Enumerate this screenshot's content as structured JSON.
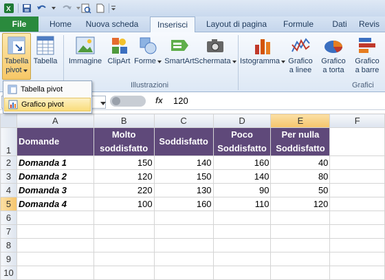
{
  "ribbon_tabs": [
    {
      "label": "File"
    },
    {
      "label": "Home"
    },
    {
      "label": "Nuova scheda"
    },
    {
      "label": "Inserisci"
    },
    {
      "label": "Layout di pagina"
    },
    {
      "label": "Formule"
    },
    {
      "label": "Dati"
    },
    {
      "label": "Revis"
    }
  ],
  "ribbon": {
    "pivot_label1": "Tabella",
    "pivot_label2": "pivot",
    "table_label": "Tabella",
    "image_label": "Immagine",
    "clipart_label": "ClipArt",
    "shapes_label": "Forme",
    "smartart_label": "SmartArt",
    "screenshot_label": "Schermata",
    "histogram_label": "Istogramma",
    "line_chart_label1": "Grafico",
    "line_chart_label2": "a linee",
    "pie_chart_label1": "Grafico",
    "pie_chart_label2": "a torta",
    "bar_chart_label1": "Grafico",
    "bar_chart_label2": "a barre",
    "group_illustrations": "Illustrazioni",
    "group_charts": "Grafici"
  },
  "pivot_menu": {
    "item1": "Tabella pivot",
    "item2": "Grafico pivot"
  },
  "formula_bar": {
    "fx": "fx",
    "value": "120"
  },
  "sheet": {
    "columns": [
      "A",
      "B",
      "C",
      "D",
      "E",
      "F"
    ],
    "row_numbers": [
      "1",
      "2",
      "3",
      "4",
      "5",
      "6",
      "7",
      "8",
      "9",
      "10"
    ],
    "header": {
      "a": "Domande",
      "b_line1": "Molto",
      "b_line2": "soddisfatto",
      "c": "Soddisfatto",
      "d_line1": "Poco",
      "d_line2": "Soddisfatto",
      "e_line1": "Per nulla",
      "e_line2": "Soddisfatto"
    },
    "rows": [
      {
        "label": "Domanda 1",
        "b": "150",
        "c": "140",
        "d": "160",
        "e": "40"
      },
      {
        "label": "Domanda 2",
        "b": "120",
        "c": "150",
        "d": "140",
        "e": "80"
      },
      {
        "label": "Domanda 3",
        "b": "220",
        "c": "130",
        "d": "90",
        "e": "50"
      },
      {
        "label": "Domanda 4",
        "b": "100",
        "c": "160",
        "d": "110",
        "e": "120"
      }
    ]
  },
  "colors": {
    "header_fill": "#5f497a",
    "file_tab": "#2a8a3d"
  }
}
